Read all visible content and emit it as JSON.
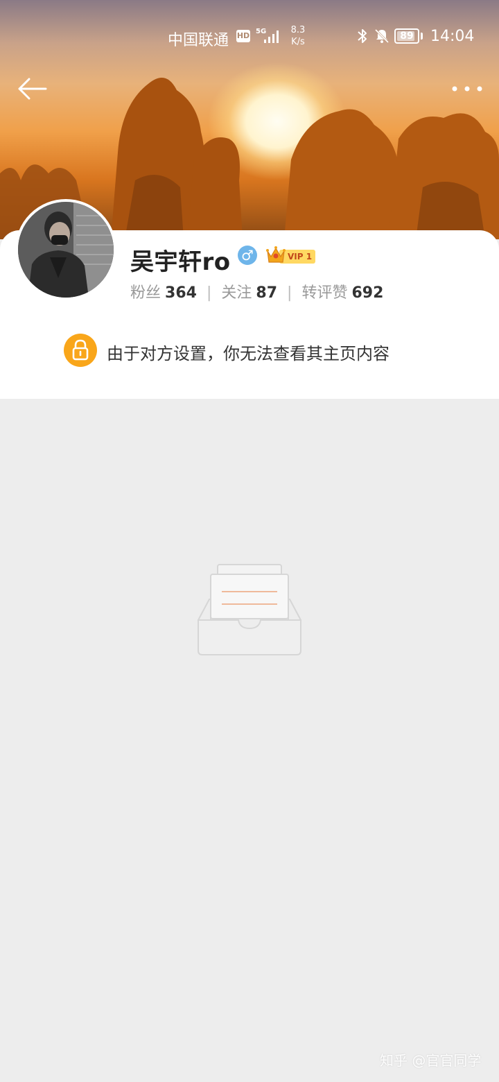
{
  "status_bar": {
    "carrier": "中国联通",
    "hd": "HD",
    "network": "5G",
    "speed_value": "8.3",
    "speed_unit": "K/s",
    "battery_level": "89",
    "time": "14:04"
  },
  "nav": {
    "back_icon": "arrow-left-icon",
    "more_icon": "more-horizontal-icon"
  },
  "profile": {
    "username": "吴宇轩ro",
    "gender_symbol": "♂",
    "vip_label": "VIP 1",
    "stats": [
      {
        "label": "粉丝",
        "value": "364"
      },
      {
        "label": "关注",
        "value": "87"
      },
      {
        "label": "转评赞",
        "value": "692"
      }
    ],
    "stat_separator": "|"
  },
  "privacy_notice": {
    "icon": "lock-icon",
    "message": "由于对方设置，你无法查看其主页内容"
  },
  "empty_state": {
    "icon": "empty-inbox-icon"
  },
  "watermark": "知乎 @官官同学",
  "colors": {
    "accent_orange": "#f9a61a",
    "gender_blue": "#6eb5ea",
    "vip_gold": "#ffd862",
    "page_bg": "#ededed"
  }
}
